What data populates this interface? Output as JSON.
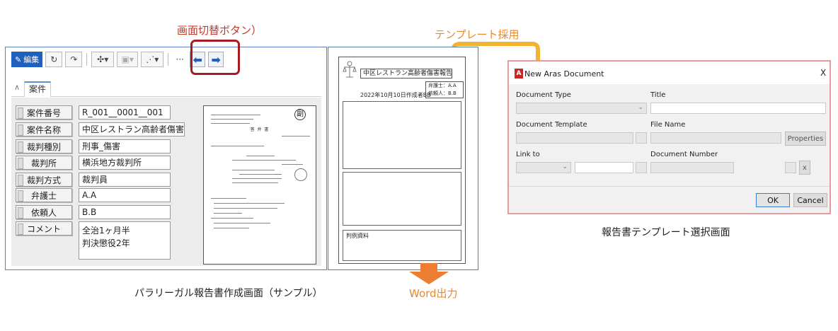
{
  "annotations": {
    "switch_button": "画面切替ボタン）",
    "template_adopt": "テンプレート採用",
    "paralegal_caption": "パラリーガル報告書作成画面（サンプル）",
    "word_output": "Word出力",
    "template_select_caption": "報告書テンプレート選択画面"
  },
  "toolbar": {
    "edit_label": "編集"
  },
  "tabs": {
    "case_tab": "案件"
  },
  "form": {
    "fields": [
      {
        "label": "案件番号",
        "value": "R_001__0001__001"
      },
      {
        "label": "案件名称",
        "value": "中区レストラン高齢者傷害"
      },
      {
        "label": "裁判種別",
        "value": "刑事_傷害"
      },
      {
        "label": "裁判所",
        "value": "横浜地方裁判所"
      },
      {
        "label": "裁判方式",
        "value": "裁判員"
      },
      {
        "label": "弁護士",
        "value": "A.A"
      },
      {
        "label": "依頼人",
        "value": "B.B"
      }
    ],
    "comment_label": "コメント",
    "comment_line1": "全治1ヶ月半",
    "comment_line2": "判決懲役2年"
  },
  "doc_preview": {
    "stamp": "副",
    "heading": "答 弁 書"
  },
  "template": {
    "title": "中区レストラン高齢者傷害報告",
    "lawyer": "弁護士：A.A",
    "client": "依頼人：B.B",
    "date_author": "2022年10月10日作成者BB",
    "section_ref": "判例資料"
  },
  "dialog": {
    "title": "New Aras Document",
    "close": "X",
    "document_type_label": "Document Type",
    "title_label": "Title",
    "document_template_label": "Document Template",
    "file_name_label": "File Name",
    "properties_button": "Properties",
    "link_to_label": "Link to",
    "document_number_label": "Document Number",
    "x_button": "x",
    "ok_button": "OK",
    "cancel_button": "Cancel"
  },
  "colors": {
    "highlight_red": "#a51c24",
    "annotation_red": "#c0392b",
    "annotation_orange": "#e8892a",
    "toolbar_primary": "#1f5fbf",
    "dialog_border": "#e89aa0"
  }
}
